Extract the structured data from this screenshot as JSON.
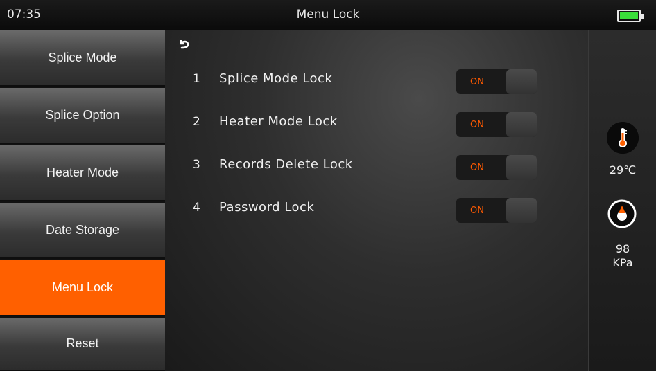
{
  "status_bar": {
    "time": "07:35",
    "title": "Menu Lock",
    "battery_level": 1.0,
    "battery_color": "#3adf3a"
  },
  "sidebar": {
    "items": [
      {
        "label": "Splice Mode"
      },
      {
        "label": "Splice Option"
      },
      {
        "label": "Heater Mode"
      },
      {
        "label": "Date Storage"
      },
      {
        "label": "Menu Lock",
        "active": true
      },
      {
        "label": "Reset"
      }
    ],
    "active_color": "#ff6000"
  },
  "main": {
    "settings": [
      {
        "number": "1",
        "label": "Splice Mode Lock",
        "state": "ON"
      },
      {
        "number": "2",
        "label": "Heater Mode Lock",
        "state": "ON"
      },
      {
        "number": "3",
        "label": "Records Delete Lock",
        "state": "ON"
      },
      {
        "number": "4",
        "label": "Password Lock",
        "state": "ON"
      }
    ],
    "toggle_on_color": "#ff5a00"
  },
  "right_panel": {
    "temperature": "29℃",
    "pressure_value": "98",
    "pressure_unit": "KPa"
  }
}
